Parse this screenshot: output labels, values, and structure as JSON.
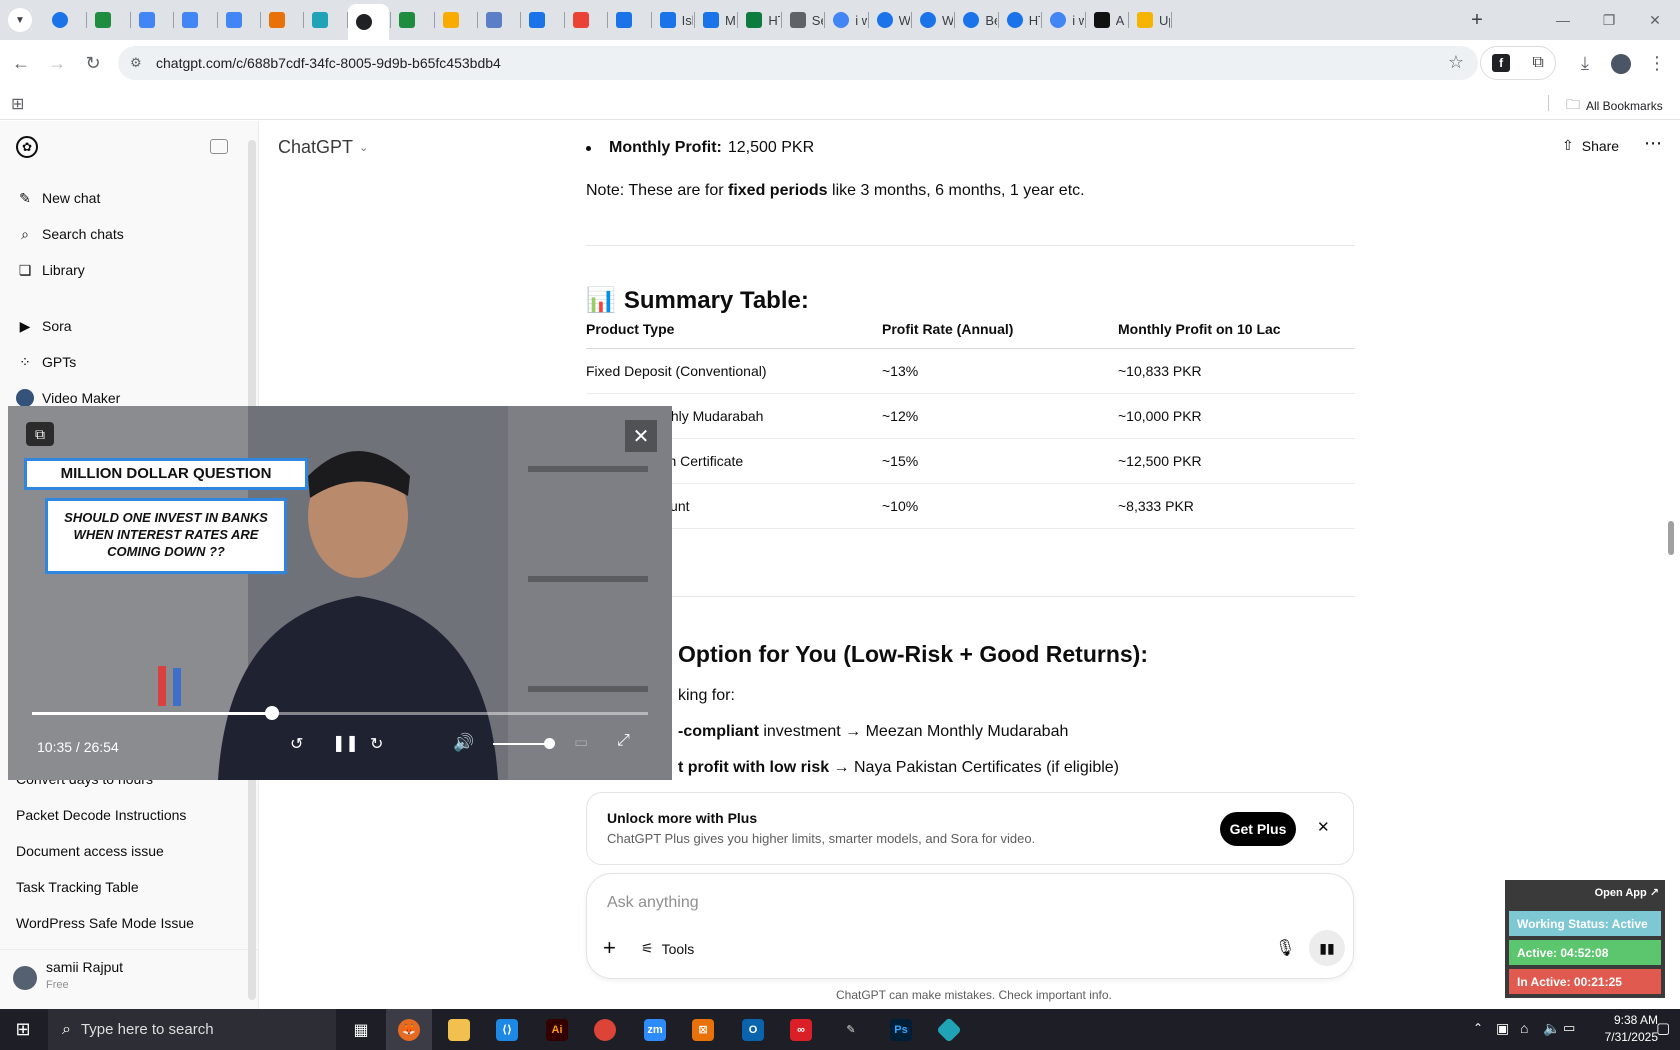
{
  "browser": {
    "tabs": [
      {
        "label": "",
        "color": "#1a73e8",
        "icon": "circle"
      },
      {
        "label": "",
        "color": "#1e8e3e",
        "icon": "plus-sheet"
      },
      {
        "label": "",
        "color": "#4285f4",
        "icon": "doc"
      },
      {
        "label": "",
        "color": "#4285f4",
        "icon": "doc"
      },
      {
        "label": "",
        "color": "#4285f4",
        "icon": "doc"
      },
      {
        "label": "",
        "color": "#e8710a",
        "icon": "box"
      },
      {
        "label": "",
        "color": "#20a3b5",
        "icon": "diamond"
      },
      {
        "label": "",
        "color": "#202124",
        "icon": "chatgpt"
      },
      {
        "label": "",
        "color": "#1e8e3e",
        "icon": "plus-sheet"
      },
      {
        "label": "",
        "color": "#f9ab00",
        "icon": "hand"
      },
      {
        "label": "",
        "color": "#5b7ec6",
        "icon": "grid"
      },
      {
        "label": "",
        "color": "#1a73e8",
        "icon": "docs"
      },
      {
        "label": "",
        "color": "#ea4335",
        "icon": "youtube"
      },
      {
        "label": "",
        "color": "#1a73e8",
        "icon": "docs"
      },
      {
        "label": "Isla",
        "color": "#1a73e8",
        "icon": "docs"
      },
      {
        "label": "Mu",
        "color": "#1a73e8",
        "icon": "docs"
      },
      {
        "label": "HTI",
        "color": "#0d7a3e",
        "icon": "w"
      },
      {
        "label": "Set",
        "color": "#5f6368",
        "icon": "gear"
      },
      {
        "label": "i wa",
        "color": "#4285f4",
        "icon": "google"
      },
      {
        "label": "We",
        "color": "#1a73e8",
        "icon": "c"
      },
      {
        "label": "Wh",
        "color": "#1a73e8",
        "icon": "c"
      },
      {
        "label": "Bes",
        "color": "#1a73e8",
        "icon": "c"
      },
      {
        "label": "HTI",
        "color": "#1a73e8",
        "icon": "c"
      },
      {
        "label": "i wa",
        "color": "#4285f4",
        "icon": "google"
      },
      {
        "label": "A n",
        "color": "#111",
        "icon": "a"
      },
      {
        "label": "Upl",
        "color": "#f4b400",
        "icon": "hat"
      }
    ],
    "url": "chatgpt.com/c/688b7cdf-34fc-8005-9d9b-b65fc453bdb4",
    "all_bookmarks": "All Bookmarks"
  },
  "sidebar": {
    "nav": [
      {
        "label": "New chat",
        "icon": "edit-icon"
      },
      {
        "label": "Search chats",
        "icon": "search-icon"
      },
      {
        "label": "Library",
        "icon": "library-icon"
      }
    ],
    "apps": [
      {
        "label": "Sora",
        "icon": "play-icon"
      },
      {
        "label": "GPTs",
        "icon": "grid-icon"
      },
      {
        "label": "Video Maker",
        "icon": "avatar-icon"
      }
    ],
    "history": [
      "Convert days to hours",
      "Packet Decode Instructions",
      "Document access issue",
      "Task Tracking Table",
      "WordPress Safe Mode Issue"
    ],
    "user": {
      "name": "samii Rajput",
      "plan": "Free"
    }
  },
  "header": {
    "model": "ChatGPT",
    "share": "Share"
  },
  "content": {
    "bullet_label": "Monthly Profit:",
    "bullet_value": "12,500 PKR",
    "note_prefix": "Note: These are for ",
    "note_bold": "fixed periods",
    "note_suffix": " like 3 months, 6 months, 1 year etc.",
    "summary_emoji": "📊",
    "summary_title": "Summary Table:",
    "table": {
      "headers": [
        "Product Type",
        "Profit Rate (Annual)",
        "Monthly Profit on 10 Lac"
      ],
      "rows": [
        [
          "Fixed Deposit (Conventional)",
          "~13%",
          "~10,833 PKR"
        ],
        [
          "Meezan Monthly Mudarabah",
          "~12%",
          "~10,000 PKR"
        ],
        [
          "Naya Pakistan Certificate",
          "~15%",
          "~12,500 PKR"
        ],
        [
          "Savings Account",
          "~10%",
          "~8,333 PKR"
        ]
      ]
    },
    "best_option_title": "Option for You (Low-Risk + Good Returns):",
    "looking_for": "king for:",
    "line1_bold": "-compliant",
    "line1_rest": " investment → Meezan Monthly Mudarabah",
    "line2_bold": "t profit with low risk",
    "line2_rest": " → Naya Pakistan Certificates (if eligible)"
  },
  "plus_card": {
    "title": "Unlock more with Plus",
    "subtitle": "ChatGPT Plus gives you higher limits, smarter models, and Sora for video.",
    "button": "Get Plus"
  },
  "composer": {
    "placeholder": "Ask anything",
    "tools": "Tools",
    "disclaimer": "ChatGPT can make mistakes. Check important info."
  },
  "video": {
    "banner_title": "MILLION DOLLAR QUESTION",
    "banner_question": "SHOULD ONE INVEST IN BANKS WHEN INTEREST RATES ARE COMING DOWN ??",
    "time": "10:35 / 26:54",
    "progress": 0.39,
    "volume": 0.9
  },
  "tracker": {
    "open_app": "Open App ↗",
    "status": "Working Status: Active",
    "active": "Active: 04:52:08",
    "inactive": "In Active: 00:21:25",
    "colors": {
      "status": "#7ec8d3",
      "active": "#5cc66e",
      "inactive": "#e05a4f"
    }
  },
  "taskbar": {
    "search_placeholder": "Type here to search",
    "time": "9:38 AM",
    "date": "7/31/2025"
  }
}
